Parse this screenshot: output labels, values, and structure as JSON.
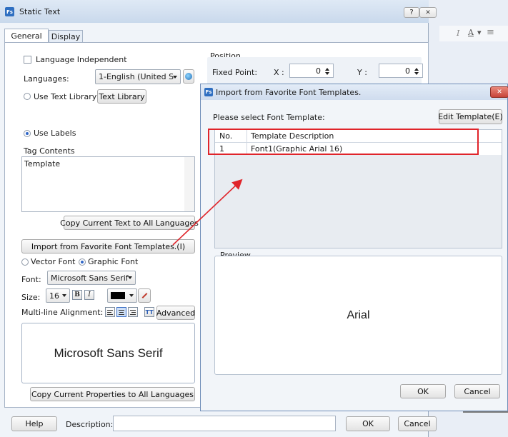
{
  "main_window": {
    "title": "Static Text",
    "app_icon_text": "Fs",
    "help_glyph": "?",
    "close_glyph": "✕",
    "tabs": [
      "General",
      "Display"
    ],
    "language_independent": "Language Independent",
    "languages_label": "Languages:",
    "language_value": "1-English (United S",
    "use_text_library": "Use Text Library",
    "text_library_button": "Text Library",
    "use_labels": "Use Labels",
    "tag_contents_label": "Tag Contents",
    "tag_contents_value": "Template",
    "copy_text_button": "Copy Current Text to All Languages",
    "import_button": "Import from Favorite Font Templates.(I)",
    "vector_font": "Vector Font",
    "graphic_font": "Graphic Font",
    "font_label": "Font:",
    "font_value": "Microsoft Sans Serif",
    "size_label": "Size:",
    "size_value": "16",
    "bold_glyph": "B",
    "italic_glyph": "I",
    "multiline_label": "Multi-line Alignment:",
    "tt_glyph": "TT",
    "advanced_button": "Advanced",
    "preview_text": "Microsoft Sans Serif",
    "copy_properties_button": "Copy Current Properties to All Languages",
    "position_label": "Position",
    "fixed_point_label": "Fixed Point:",
    "x_label": "X :",
    "x_value": "0",
    "y_label": "Y :",
    "y_value": "0",
    "help_button": "Help",
    "description_label": "Description:",
    "ok_button": "OK",
    "cancel_button": "Cancel"
  },
  "background_toolbar": {
    "italic_glyph": "I",
    "color_glyph": "A",
    "dropdown_glyph": "▾",
    "list_glyph": "≡"
  },
  "dialog": {
    "title": "Import from Favorite Font Templates.",
    "app_icon_text": "Fs",
    "close_glyph": "✕",
    "prompt": "Please select Font Template:",
    "edit_template_button": "Edit Template(E)",
    "columns": [
      "No.",
      "Template Description"
    ],
    "rows": [
      {
        "no": "1",
        "description": "Font1(Graphic Arial 16)"
      }
    ],
    "preview_label": "Preview",
    "preview_text": "Arial",
    "ok_button": "OK",
    "cancel_button": "Cancel"
  },
  "colors": {
    "highlight_red": "#e0242a",
    "dialog_title_blue": "#3a6fc0"
  }
}
